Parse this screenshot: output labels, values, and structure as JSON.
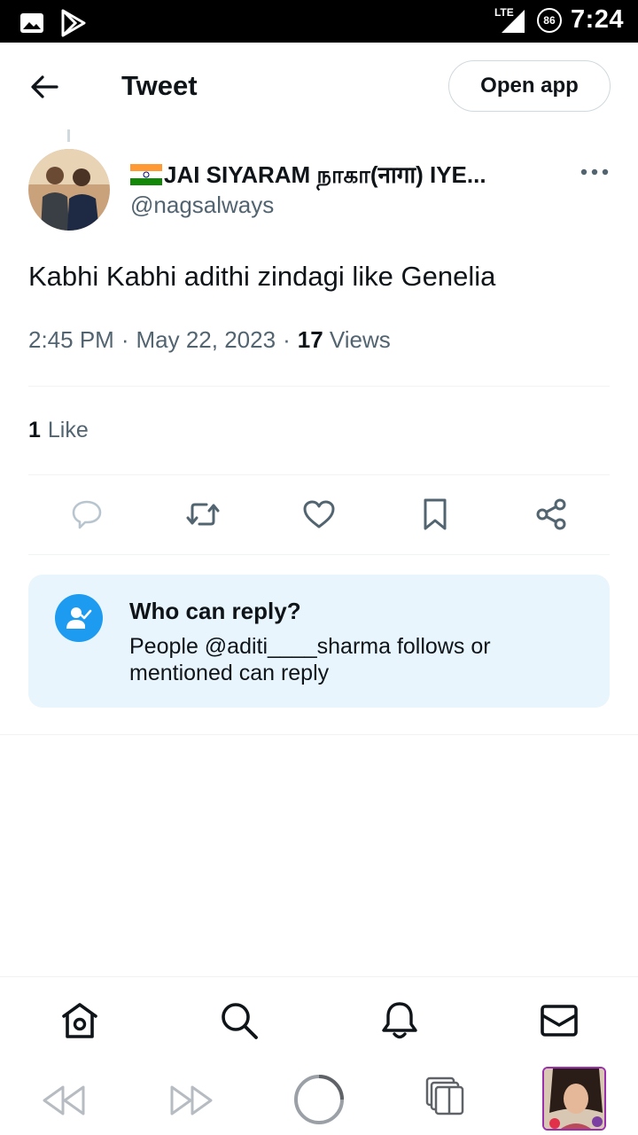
{
  "status_bar": {
    "time": "7:24",
    "network": "LTE",
    "battery": "86"
  },
  "header": {
    "title": "Tweet",
    "open_app_label": "Open app"
  },
  "tweet": {
    "author_name": "JAI SIYARAM நாகா(नागा) IYE...",
    "author_handle": "@nagsalways",
    "text": "Kabhi Kabhi adithi zindagi like Genelia",
    "time": "2:45 PM",
    "date": "May 22, 2023",
    "views_count": "17",
    "views_label": "Views",
    "likes_count": "1",
    "likes_label": "Like"
  },
  "reply_restriction": {
    "title": "Who can reply?",
    "description": "People @aditi____sharma follows or mentioned can reply"
  },
  "colors": {
    "accent": "#1d9bf0",
    "secondary_text": "#536471",
    "card_bg": "#e8f5fd",
    "thumb_border": "#9b2fae"
  },
  "icons": {
    "actions": [
      "reply-icon",
      "retweet-icon",
      "like-icon",
      "bookmark-icon",
      "share-icon"
    ],
    "nav": [
      "home-icon",
      "search-icon",
      "notifications-icon",
      "messages-icon"
    ],
    "browser": [
      "rewind-icon",
      "fast-forward-icon",
      "loading-icon",
      "tabs-icon"
    ]
  }
}
